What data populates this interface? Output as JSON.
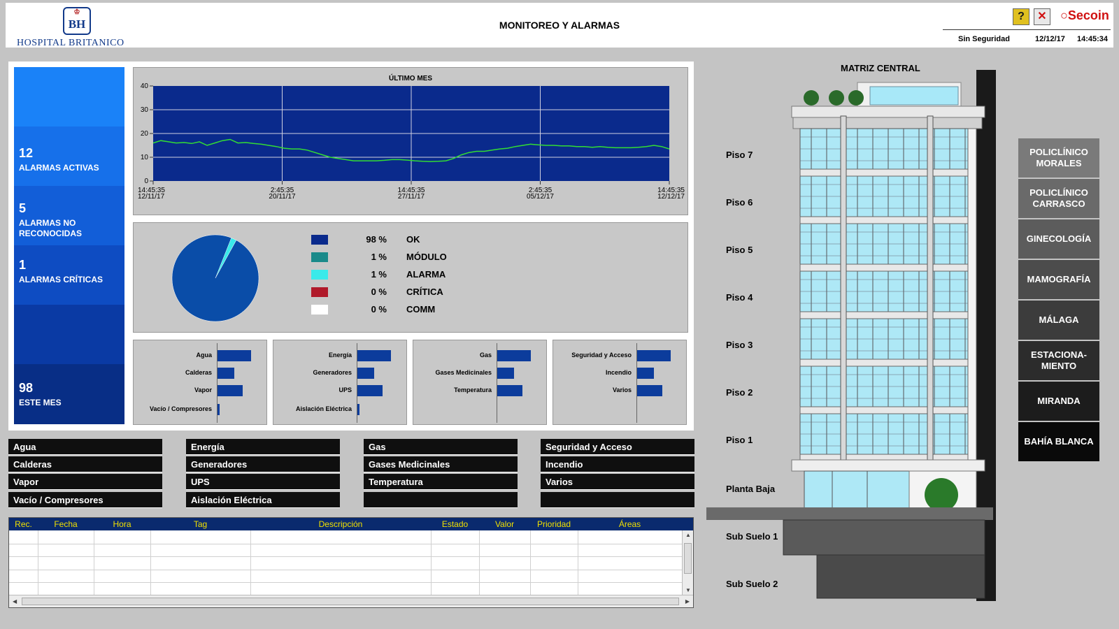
{
  "header": {
    "logo_emblem": "BH",
    "logo_text": "HOSPITAL BRITANICO",
    "title": "MONITOREO Y ALARMAS",
    "help_icon": "?",
    "close_icon": "✕",
    "brand": "Secoin",
    "security": "Sin Seguridad",
    "date": "12/12/17",
    "time": "14:45:34"
  },
  "stats": {
    "active": {
      "value": "12",
      "label": "ALARMAS ACTIVAS"
    },
    "unacknowledged": {
      "value": "5",
      "label": "ALARMAS NO RECONOCIDAS"
    },
    "critical": {
      "value": "1",
      "label": "ALARMAS CRÍTICAS"
    },
    "month": {
      "value": "98",
      "label": "ESTE MES"
    }
  },
  "chart_data": [
    {
      "type": "line",
      "title": "ÚLTIMO MES",
      "ylim": [
        0,
        40
      ],
      "yticks": [
        "0",
        "10",
        "20",
        "30",
        "40"
      ],
      "xticks": [
        {
          "time": "14:45:35",
          "date": "12/11/17"
        },
        {
          "time": "2:45:35",
          "date": "20/11/17"
        },
        {
          "time": "14:45:35",
          "date": "27/11/17"
        },
        {
          "time": "2:45:35",
          "date": "05/12/17"
        },
        {
          "time": "14:45:35",
          "date": "12/12/17"
        }
      ],
      "grid": true,
      "line_color": "#33dd33",
      "background": "#0a2a8c",
      "series": [
        {
          "values": [
            16,
            17,
            16.5,
            16,
            16.2,
            15.8,
            16.5,
            15,
            16,
            17,
            17.5,
            16,
            16.2,
            15.8,
            15.5,
            15,
            14.5,
            13.8,
            13.5,
            13.5,
            13,
            12,
            11,
            10,
            9.5,
            9,
            8.5,
            8.5,
            8.5,
            8.5,
            8.7,
            9,
            9,
            8.8,
            8.5,
            8.3,
            8.2,
            8.3,
            8.5,
            9.5,
            11,
            12,
            12.5,
            12.5,
            13,
            13.5,
            13.8,
            14.5,
            15,
            15.5,
            15.2,
            15,
            15,
            14.8,
            14.8,
            14.5,
            14.5,
            14.2,
            14.5,
            14.2,
            14,
            14,
            14,
            14.2,
            14.5,
            15,
            14.5,
            13.5
          ]
        }
      ]
    },
    {
      "type": "pie",
      "slices": [
        {
          "label": "OK",
          "value": 98,
          "display": "98 %",
          "color": "#0a2a8c",
          "pie_color": "#0a4da8"
        },
        {
          "label": "MÓDULO",
          "value": 1,
          "display": "1 %",
          "color": "#1a8a8a"
        },
        {
          "label": "ALARMA",
          "value": 1,
          "display": "1 %",
          "color": "#3aeaea"
        },
        {
          "label": "CRÍTICA",
          "value": 0,
          "display": "0 %",
          "color": "#b01a2a"
        },
        {
          "label": "COMM",
          "value": 0,
          "display": "0 %",
          "color": "#ffffff"
        }
      ]
    },
    {
      "type": "bar",
      "orientation": "horizontal",
      "groups": [
        {
          "categories": [
            "Agua",
            "Calderas",
            "Vapor",
            "Vacío / Compresores"
          ],
          "values": [
            4,
            2,
            3,
            0.2
          ]
        },
        {
          "categories": [
            "Energía",
            "Generadores",
            "UPS",
            "Aislación Eléctrica"
          ],
          "values": [
            4,
            2,
            3,
            0.2
          ]
        },
        {
          "categories": [
            "Gas",
            "Gases Medicinales",
            "Temperatura"
          ],
          "values": [
            4,
            2,
            3
          ]
        },
        {
          "categories": [
            "Seguridad y Acceso",
            "Incendio",
            "Varios"
          ],
          "values": [
            4,
            2,
            3
          ]
        }
      ]
    }
  ],
  "buttons": {
    "col1": [
      "Agua",
      "Calderas",
      "Vapor",
      "Vacío / Compresores"
    ],
    "col2": [
      "Energía",
      "Generadores",
      "UPS",
      "Aislación Eléctrica"
    ],
    "col3": [
      "Gas",
      "Gases Medicinales",
      "Temperatura",
      ""
    ],
    "col4": [
      "Seguridad y Acceso",
      "Incendio",
      "Varios",
      ""
    ]
  },
  "table": {
    "columns": [
      "Rec.",
      "Fecha",
      "Hora",
      "Tag",
      "Descripción",
      "Estado",
      "Valor",
      "Prioridad",
      "Áreas"
    ],
    "rows": []
  },
  "building": {
    "title": "MATRIZ CENTRAL",
    "floors": [
      "Piso 7",
      "Piso 6",
      "Piso 5",
      "Piso 4",
      "Piso 3",
      "Piso 2",
      "Piso 1",
      "Planta Baja",
      "Sub Suelo 1",
      "Sub Suelo 2"
    ]
  },
  "sites": [
    {
      "label": "POLICLÍNICO MORALES",
      "color": "#7a7a7a"
    },
    {
      "label": "POLICLÍNICO CARRASCO",
      "color": "#6a6a6a"
    },
    {
      "label": "GINECOLOGÍA",
      "color": "#5c5c5c"
    },
    {
      "label": "MAMOGRAFÍA",
      "color": "#4c4c4c"
    },
    {
      "label": "MÁLAGA",
      "color": "#3c3c3c"
    },
    {
      "label": "ESTACIONA-MIENTO",
      "color": "#2c2c2c"
    },
    {
      "label": "MIRANDA",
      "color": "#1c1c1c"
    },
    {
      "label": "BAHÍA BLANCA",
      "color": "#0a0a0a"
    }
  ]
}
